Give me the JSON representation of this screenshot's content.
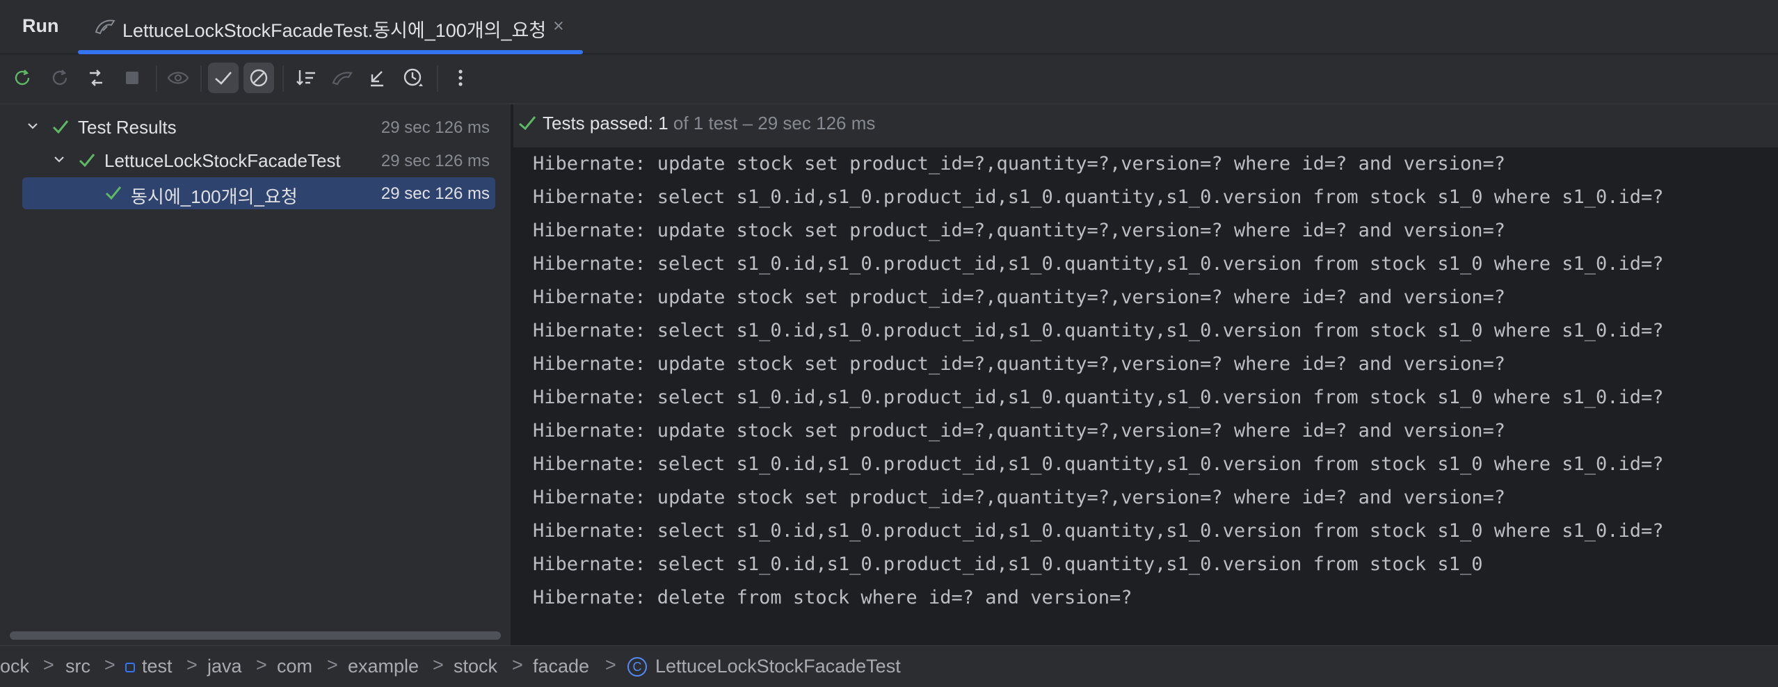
{
  "tabbar": {
    "run_label": "Run",
    "tab_title": "LettuceLockStockFacadeTest.동시에_100개의_요청",
    "close_glyph": "×",
    "accent_color": "#3574f0"
  },
  "toolbar": {
    "buttons": [
      "rerun-icon",
      "rerun-failed-icon",
      "toggle-auto-test-icon",
      "stop-icon",
      "show-passed-eye-icon",
      "show-passed-check-icon",
      "show-ignored-icon",
      "sort-icon",
      "import-tests-icon",
      "export-collapse-icon",
      "history-clock-icon",
      "more-options-icon"
    ]
  },
  "tree": {
    "items": [
      {
        "label": "Test Results",
        "time": "29 sec 126 ms"
      },
      {
        "label": "LettuceLockStockFacadeTest",
        "time": "29 sec 126 ms"
      },
      {
        "label": "동시에_100개의_요청",
        "time": "29 sec 126 ms"
      }
    ],
    "pass_color": "#5fb865"
  },
  "status": {
    "label": "Tests passed: 1",
    "detail": " of 1 test – 29 sec 126 ms"
  },
  "console": {
    "lines": [
      "Hibernate: update stock set product_id=?,quantity=?,version=? where id=? and version=?",
      "Hibernate: select s1_0.id,s1_0.product_id,s1_0.quantity,s1_0.version from stock s1_0 where s1_0.id=?",
      "Hibernate: update stock set product_id=?,quantity=?,version=? where id=? and version=?",
      "Hibernate: select s1_0.id,s1_0.product_id,s1_0.quantity,s1_0.version from stock s1_0 where s1_0.id=?",
      "Hibernate: update stock set product_id=?,quantity=?,version=? where id=? and version=?",
      "Hibernate: select s1_0.id,s1_0.product_id,s1_0.quantity,s1_0.version from stock s1_0 where s1_0.id=?",
      "Hibernate: update stock set product_id=?,quantity=?,version=? where id=? and version=?",
      "Hibernate: select s1_0.id,s1_0.product_id,s1_0.quantity,s1_0.version from stock s1_0 where s1_0.id=?",
      "Hibernate: update stock set product_id=?,quantity=?,version=? where id=? and version=?",
      "Hibernate: select s1_0.id,s1_0.product_id,s1_0.quantity,s1_0.version from stock s1_0 where s1_0.id=?",
      "Hibernate: update stock set product_id=?,quantity=?,version=? where id=? and version=?",
      "Hibernate: select s1_0.id,s1_0.product_id,s1_0.quantity,s1_0.version from stock s1_0 where s1_0.id=?",
      "Hibernate: select s1_0.id,s1_0.product_id,s1_0.quantity,s1_0.version from stock s1_0",
      "Hibernate: delete from stock where id=? and version=?"
    ]
  },
  "breadcrumb": {
    "items": [
      "ock",
      "src",
      "test",
      "java",
      "com",
      "example",
      "stock",
      "facade",
      "LettuceLockStockFacadeTest"
    ],
    "separator": ">",
    "class_glyph": "C"
  }
}
